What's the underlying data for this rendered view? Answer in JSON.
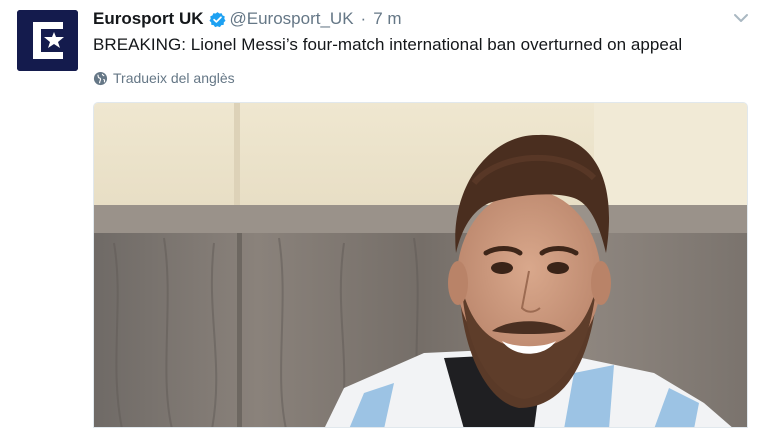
{
  "tweet": {
    "display_name": "Eurosport UK",
    "handle": "@Eurosport_UK",
    "separator": "·",
    "time": "7 m",
    "text": "BREAKING: Lionel Messi’s four-match international ban overturned on appeal",
    "translate_label": "Tradueix del anglès",
    "avatar_icon": "eurosport-logo",
    "verified_icon": "verified-badge-icon",
    "menu_icon": "chevron-down-icon",
    "photo_icon": "photo-bearded-man-in-striped-shirt"
  },
  "colors": {
    "brand_navy": "#141b4d",
    "verified_blue": "#1da1f2",
    "muted_text": "#657786"
  }
}
